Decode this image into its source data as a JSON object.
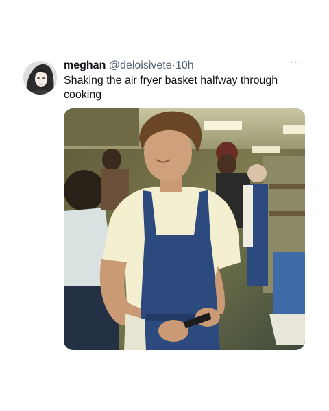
{
  "tweet": {
    "display_name": "meghan",
    "handle": "@deloisivete",
    "separator": "·",
    "time": "10h",
    "text": "Shaking the air fryer basket halfway through cooking",
    "more_icon": "ellipsis-icon",
    "avatar_icon": "profile-photo",
    "media_icon": "kitchen-photo"
  },
  "colors": {
    "text": "#0f1419",
    "secondary": "#536471",
    "apron": "#2d4a7e",
    "shirt": "#f5efd2",
    "background": "#ffffff"
  }
}
